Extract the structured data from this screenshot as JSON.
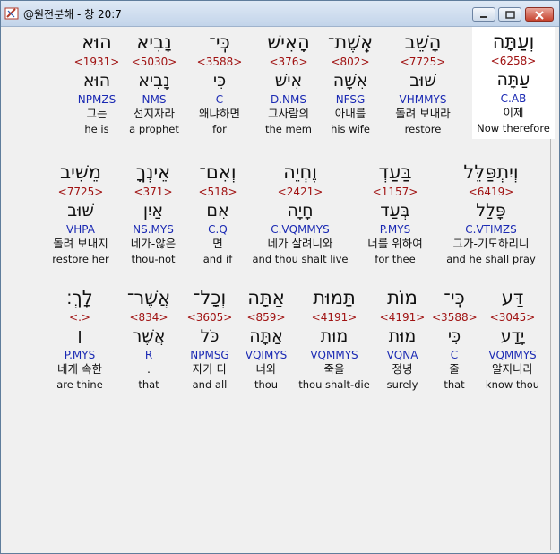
{
  "window": {
    "title": "@원전분해 - 창 20:7"
  },
  "colors": {
    "strong": "#a01212",
    "morph": "#1a29b3",
    "highlight": "#ffffff"
  },
  "rows": [
    {
      "cells": [
        {
          "heb": "וְעַתָּה",
          "strong": "<6258>",
          "root": "עַתָּה",
          "morph": "C.AB",
          "kor": "이제",
          "eng": "Now therefore",
          "hl": true
        },
        {
          "heb": "הָשֵׁב",
          "strong": "<7725>",
          "root": "שׁוּב",
          "morph": "VHMMYS",
          "kor": "돌려 보내라",
          "eng": "restore"
        },
        {
          "heb": "אֵֽשֶׁת־",
          "strong": "<802>",
          "root": "אִשָּׁה",
          "morph": "NFSG",
          "kor": "아내를",
          "eng": "his wife"
        },
        {
          "heb": "הָאִישׁ",
          "strong": "<376>",
          "root": "אִישׁ",
          "morph": "D.NMS",
          "kor": "그사람의",
          "eng": "the mem"
        },
        {
          "heb": "כִּֽי־",
          "strong": "<3588>",
          "root": "כִּי",
          "morph": "C",
          "kor": "왜냐하면",
          "eng": "for"
        },
        {
          "heb": "נָבִיא",
          "strong": "<5030>",
          "root": "נָבִיא",
          "morph": "NMS",
          "kor": "선지자라",
          "eng": "a prophet"
        },
        {
          "heb": "הוּא",
          "strong": "<1931>",
          "root": "הוּא",
          "morph": "NPMZS",
          "kor": "그는",
          "eng": "he is"
        }
      ]
    },
    {
      "cells": [
        {
          "heb": "וְיִתְפַּלֵּל",
          "strong": "<6419>",
          "root": "פָּלַל",
          "morph": "C.VTIMZS",
          "kor": "그가-기도하리니",
          "eng": "and he shall pray"
        },
        {
          "heb": "בַּעַדְ",
          "strong": "<1157>",
          "root": "בְּעַד",
          "morph": "P.MYS",
          "kor": "너를 위하여",
          "eng": "for thee"
        },
        {
          "heb": "וֶחְיֵה",
          "strong": "<2421>",
          "root": "חָיָה",
          "morph": "C.VQMMYS",
          "kor": "네가 살려니와",
          "eng": "and thou shalt live"
        },
        {
          "heb": "וְאִם־",
          "strong": "<518>",
          "root": "אִם",
          "morph": "C.Q",
          "kor": "면",
          "eng": "and if"
        },
        {
          "heb": "אֵינְךָ",
          "strong": "<371>",
          "root": "אַיִן",
          "morph": "NS.MYS",
          "kor": "네가-않은",
          "eng": "thou-not"
        },
        {
          "heb": "מֵשִׁיב",
          "strong": "<7725>",
          "root": "שׁוּב",
          "morph": "VHPA",
          "kor": "돌려 보내지",
          "eng": "restore her"
        }
      ]
    },
    {
      "cells": [
        {
          "heb": "דַּע",
          "strong": "<3045>",
          "root": "יָדַע",
          "morph": "VQMMYS",
          "kor": "알지니라",
          "eng": "know thou"
        },
        {
          "heb": "כִּֽי־",
          "strong": "<3588>",
          "root": "כִּי",
          "morph": "C",
          "kor": "줄",
          "eng": "that"
        },
        {
          "heb": "מוֹת",
          "strong": "<4191>",
          "root": "מוּת",
          "morph": "VQNA",
          "kor": "정녕",
          "eng": "surely"
        },
        {
          "heb": "תָּמוּת",
          "strong": "<4191>",
          "root": "מוּת",
          "morph": "VQMMYS",
          "kor": "죽을",
          "eng": "thou shalt-die"
        },
        {
          "heb": "אַתָּה",
          "strong": "<859>",
          "root": "אַתָּה",
          "morph": "VQIMYS",
          "kor": "너와",
          "eng": "thou"
        },
        {
          "heb": "וְכָל־",
          "strong": "<3605>",
          "root": "כֹּל",
          "morph": "NPMSG",
          "kor": "자가 다",
          "eng": "and all"
        },
        {
          "heb": "אֲשֶׁר־",
          "strong": "<834>",
          "root": "אֲשֶׁר",
          "morph": "R",
          "kor": ".",
          "eng": "that"
        },
        {
          "heb": "לָֽךְ׃",
          "strong": "<.>",
          "root": "׀",
          "morph": "P.MYS",
          "kor": "네게 속한",
          "eng": "are thine"
        }
      ]
    }
  ]
}
